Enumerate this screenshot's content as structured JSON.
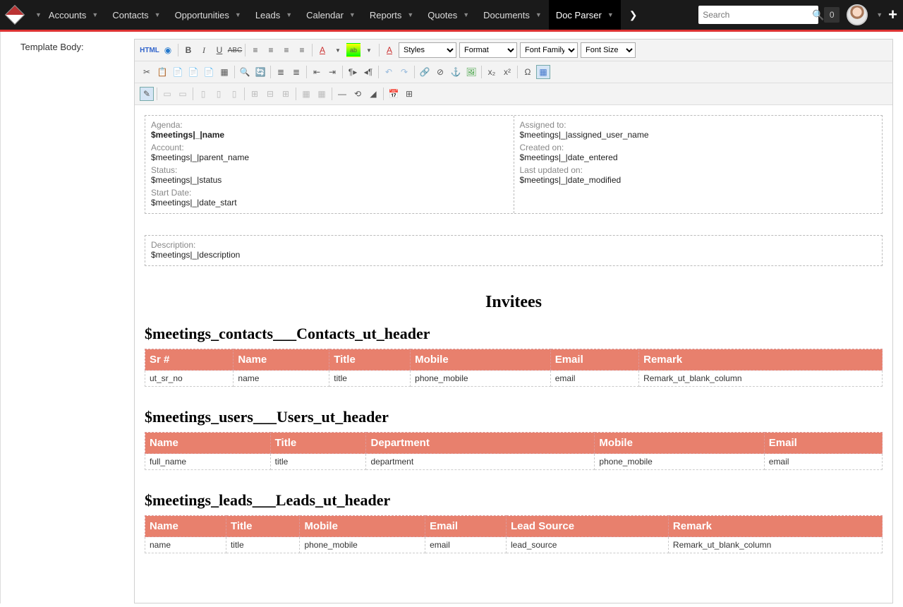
{
  "nav": {
    "items": [
      "Accounts",
      "Contacts",
      "Opportunities",
      "Leads",
      "Calendar",
      "Reports",
      "Quotes",
      "Documents",
      "Doc Parser"
    ],
    "active": "Doc Parser"
  },
  "search": {
    "placeholder": "Search"
  },
  "badge_count": "0",
  "left": {
    "label": "Template Body:"
  },
  "toolbar": {
    "html": "HTML",
    "styles": "Styles",
    "format": "Format",
    "font_family": "Font Family",
    "font_size": "Font Size"
  },
  "fields_left": [
    {
      "label": "Agenda:",
      "value": "$meetings|_|name",
      "bold": true
    },
    {
      "label": "Account:",
      "value": "$meetings|_|parent_name"
    },
    {
      "label": "Status:",
      "value": "$meetings|_|status"
    },
    {
      "label": "Start Date:",
      "value": "$meetings|_|date_start"
    }
  ],
  "fields_right": [
    {
      "label": "Assigned to:",
      "value": "$meetings|_|assigned_user_name"
    },
    {
      "label": "Created on:",
      "value": "$meetings|_|date_entered"
    },
    {
      "label": "Last updated on:",
      "value": "$meetings|_|date_modified"
    }
  ],
  "description": {
    "label": "Description:",
    "value": "$meetings|_|description"
  },
  "invitees_heading": "Invitees",
  "tables": [
    {
      "heading": "$meetings_contacts___Contacts_ut_header",
      "headers": [
        "Sr #",
        "Name",
        "Title",
        "Mobile",
        "Email",
        "Remark"
      ],
      "row": [
        "ut_sr_no",
        "name",
        "title",
        "phone_mobile",
        "email",
        "Remark_ut_blank_column"
      ],
      "widths": [
        "12%",
        "13%",
        "11%",
        "19%",
        "12%",
        "33%"
      ]
    },
    {
      "heading": "$meetings_users___Users_ut_header",
      "headers": [
        "Name",
        "Title",
        "Department",
        "Mobile",
        "Email"
      ],
      "row": [
        "full_name",
        "title",
        "department",
        "phone_mobile",
        "email"
      ],
      "widths": [
        "17%",
        "13%",
        "31%",
        "23%",
        "16%"
      ]
    },
    {
      "heading": "$meetings_leads___Leads_ut_header",
      "headers": [
        "Name",
        "Title",
        "Mobile",
        "Email",
        "Lead Source",
        "Remark"
      ],
      "row": [
        "name",
        "title",
        "phone_mobile",
        "email",
        "lead_source",
        "Remark_ut_blank_column"
      ],
      "widths": [
        "11%",
        "10%",
        "17%",
        "11%",
        "22%",
        "29%"
      ]
    }
  ]
}
